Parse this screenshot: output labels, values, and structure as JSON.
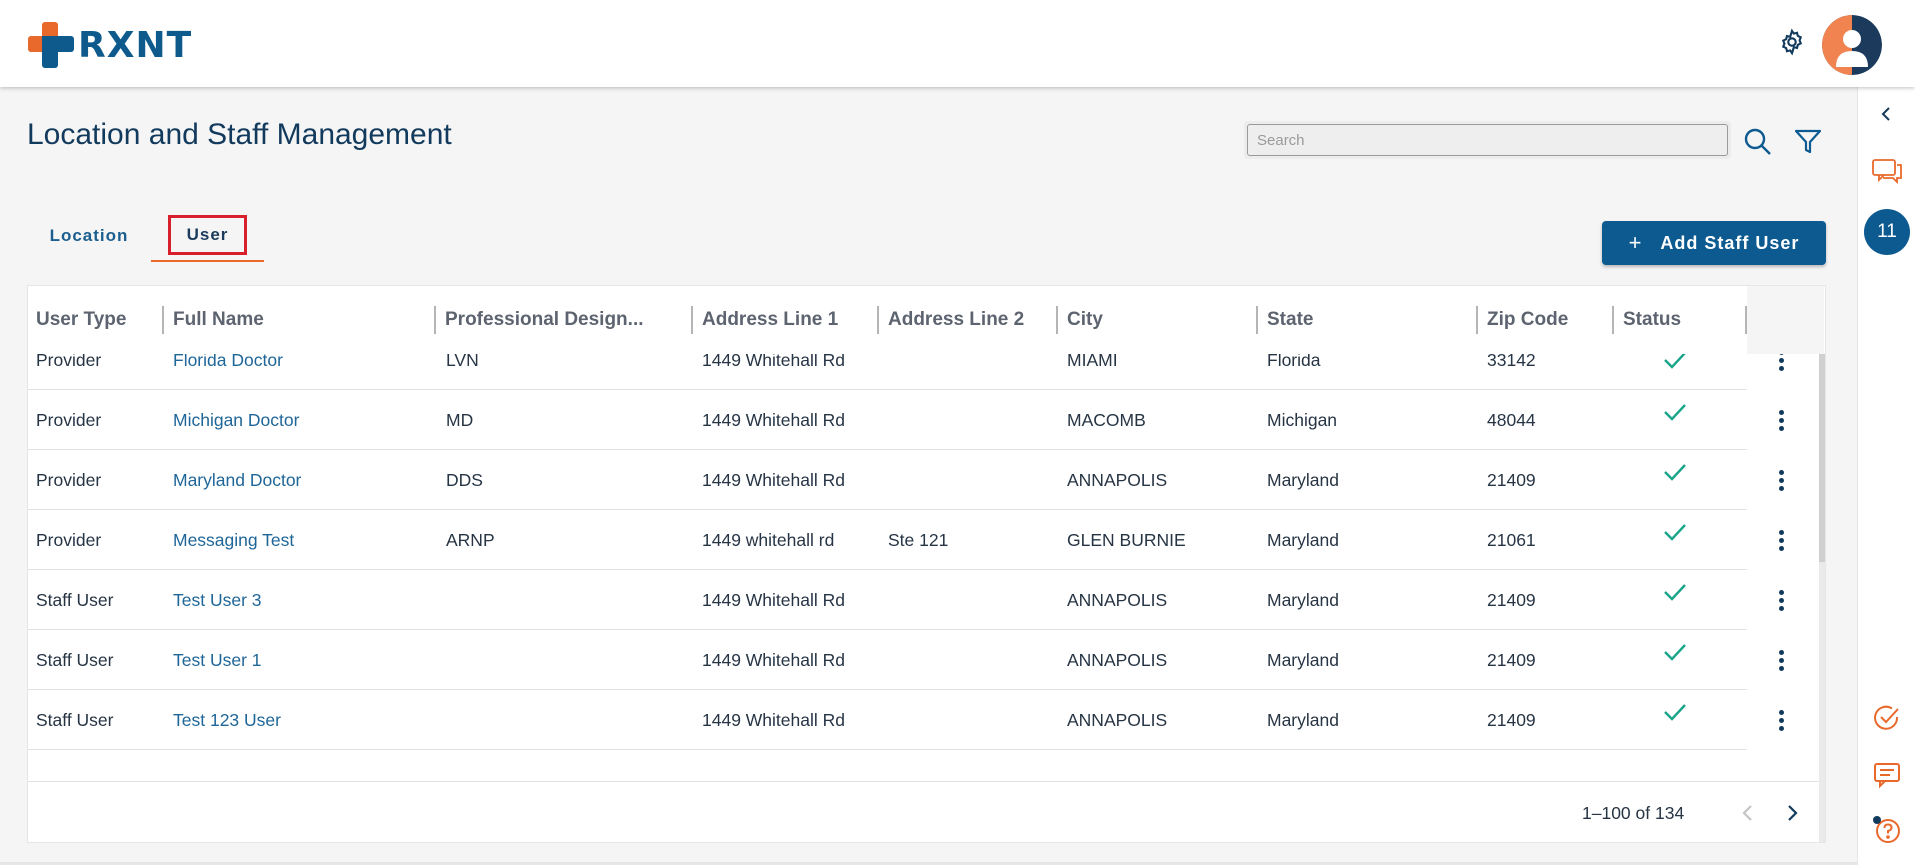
{
  "app": {
    "logo_text": "RXNT"
  },
  "colors": {
    "brand_blue": "#0d5a91",
    "brand_orange": "#e8692b",
    "check_green": "#1aa58a",
    "highlight_red": "#d7202b"
  },
  "header": {
    "settings_icon": "gear-icon",
    "avatar_icon": "user-avatar-icon"
  },
  "page": {
    "title": "Location and Staff Management"
  },
  "search": {
    "placeholder": "Search",
    "value": ""
  },
  "tabs": [
    {
      "label": "Location"
    },
    {
      "label": "User"
    }
  ],
  "active_tab": "User",
  "add_button": {
    "icon": "+",
    "label": "Add Staff User"
  },
  "table": {
    "columns": [
      "User Type",
      "Full Name",
      "Professional Design...",
      "Address Line 1",
      "Address Line 2",
      "City",
      "State",
      "Zip Code",
      "Status"
    ],
    "rows": [
      {
        "user_type": "Provider",
        "full_name": "Florida Doctor",
        "designation": "LVN",
        "address1": "1449 Whitehall Rd",
        "address2": "",
        "city": "MIAMI",
        "state": "Florida",
        "zip": "33142",
        "status": "active"
      },
      {
        "user_type": "Provider",
        "full_name": "Michigan Doctor",
        "designation": "MD",
        "address1": "1449 Whitehall Rd",
        "address2": "",
        "city": "MACOMB",
        "state": "Michigan",
        "zip": "48044",
        "status": "active"
      },
      {
        "user_type": "Provider",
        "full_name": "Maryland Doctor",
        "designation": "DDS",
        "address1": "1449 Whitehall Rd",
        "address2": "",
        "city": "ANNAPOLIS",
        "state": "Maryland",
        "zip": "21409",
        "status": "active"
      },
      {
        "user_type": "Provider",
        "full_name": "Messaging Test",
        "designation": "ARNP",
        "address1": "1449 whitehall rd",
        "address2": "Ste 121",
        "city": "GLEN BURNIE",
        "state": "Maryland",
        "zip": "21061",
        "status": "active"
      },
      {
        "user_type": "Staff User",
        "full_name": "Test User 3",
        "designation": "",
        "address1": "1449 Whitehall Rd",
        "address2": "",
        "city": "ANNAPOLIS",
        "state": "Maryland",
        "zip": "21409",
        "status": "active"
      },
      {
        "user_type": "Staff User",
        "full_name": "Test User 1",
        "designation": "",
        "address1": "1449 Whitehall Rd",
        "address2": "",
        "city": "ANNAPOLIS",
        "state": "Maryland",
        "zip": "21409",
        "status": "active"
      },
      {
        "user_type": "Staff User",
        "full_name": "Test 123 User",
        "designation": "",
        "address1": "1449 Whitehall Rd",
        "address2": "",
        "city": "ANNAPOLIS",
        "state": "Maryland",
        "zip": "21409",
        "status": "active"
      }
    ]
  },
  "pagination": {
    "text": "1–100 of 134"
  },
  "rail": {
    "badge_count": "11",
    "items": [
      "collapse-chevron-icon",
      "chat-bubbles-icon",
      "notification-count-badge",
      "task-check-icon",
      "message-icon",
      "help-icon"
    ]
  }
}
